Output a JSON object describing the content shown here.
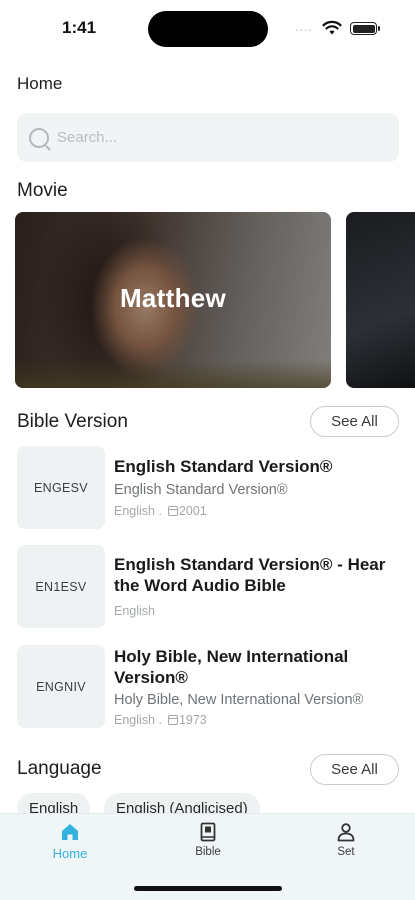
{
  "status": {
    "time": "1:41",
    "dots": "...."
  },
  "header": {
    "title": "Home"
  },
  "search": {
    "placeholder": "Search..."
  },
  "movie": {
    "section_title": "Movie",
    "cards": [
      {
        "title": "Matthew"
      }
    ]
  },
  "bible_version": {
    "section_title": "Bible Version",
    "see_all": "See All",
    "items": [
      {
        "code": "ENGESV",
        "name": "English Standard Version®",
        "subtitle": "English Standard Version®",
        "language": "English .",
        "year": "2001"
      },
      {
        "code": "EN1ESV",
        "name": "English Standard Version® - Hear the Word Audio Bible",
        "subtitle": "",
        "language": "English",
        "year": ""
      },
      {
        "code": "ENGNIV",
        "name": "Holy Bible, New International Version®",
        "subtitle": "Holy Bible, New International Version®",
        "language": "English .",
        "year": "1973"
      }
    ]
  },
  "language": {
    "section_title": "Language",
    "see_all": "See All",
    "chips": [
      "English",
      "English (Anglicised)"
    ]
  },
  "tabs": [
    {
      "label": "Home",
      "active": true,
      "icon": "home-icon"
    },
    {
      "label": "Bible",
      "active": false,
      "icon": "book-icon"
    },
    {
      "label": "Set",
      "active": false,
      "icon": "person-icon"
    }
  ],
  "colors": {
    "accent": "#32b3dd",
    "tab_bar_bg": "#f0f6f8",
    "card_bg": "#eef2f3"
  }
}
